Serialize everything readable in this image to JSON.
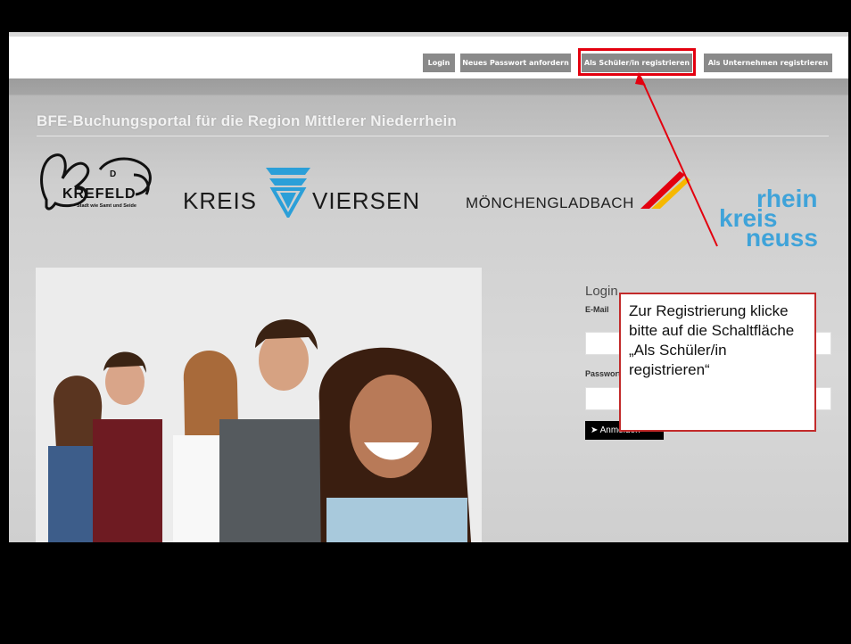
{
  "nav": {
    "login": "Login",
    "new_password": "Neues Passwort anfordern",
    "register_student": "Als Schüler/in registrieren",
    "register_company": "Als Unternehmen registrieren"
  },
  "portal": {
    "title": "BFE-Buchungsportal für die Region Mittlerer Niederrhein"
  },
  "logos": {
    "krefeld": {
      "name": "KREFELD",
      "tagline": "Stadt wie Samt und Seide",
      "mark": "D"
    },
    "kreis": "KREIS",
    "viersen": "VIERSEN",
    "moenchengladbach": "MÖNCHENGLADBACH",
    "rkn": {
      "line1": "rhein",
      "line2": "kreis",
      "line3": "neuss"
    }
  },
  "login": {
    "title": "Login",
    "email_label": "E-Mail",
    "password_label": "Passwort",
    "submit": "Anmelden"
  },
  "callout": {
    "text": "Zur Registrierung klicke bitte auf die Schaltfläche „Als Schüler/in registrieren“"
  },
  "colors": {
    "highlight_red": "#e3000f",
    "nav_button_gray": "#8a8a8a",
    "rkn_blue": "#3fa3d9"
  }
}
